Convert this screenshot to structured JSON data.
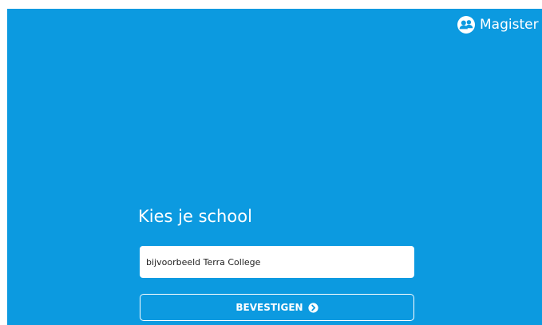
{
  "header": {
    "brand_name": "Magister",
    "brand_icon": "users-icon"
  },
  "school_select": {
    "title": "Kies je school",
    "placeholder": "bijvoorbeeld Terra College",
    "value": "",
    "confirm_label": "BEVESTIGEN",
    "confirm_icon": "chevron-circle-right-icon"
  },
  "colors": {
    "background": "#0c9ae0",
    "text": "#ffffff"
  }
}
